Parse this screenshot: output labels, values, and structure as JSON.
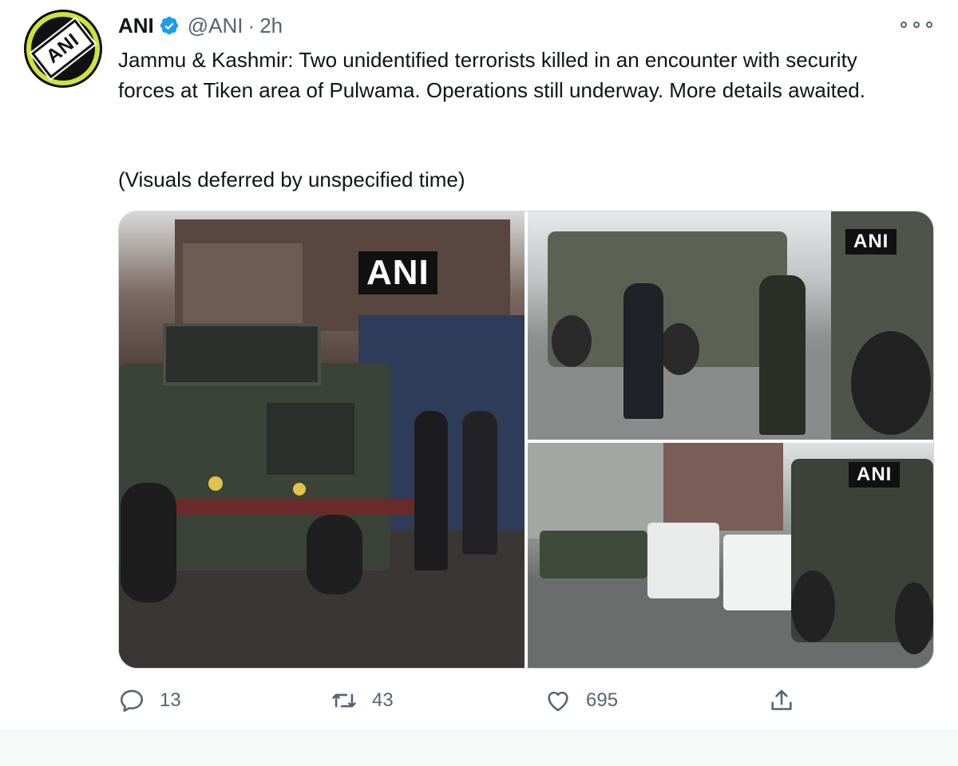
{
  "tweet": {
    "author_name": "ANI",
    "handle": "@ANI",
    "separator": "·",
    "time": "2h",
    "avatar_text": "ANI",
    "text": "Jammu & Kashmir: Two unidentified terrorists killed in an encounter with security forces at Tiken area of Pulwama. Operations still underway. More details awaited.",
    "text_secondary": "(Visuals deferred by unspecified time)",
    "media": {
      "watermark_left": "ANI",
      "watermark_top_right": "ANI",
      "watermark_bottom_right": "ANI"
    },
    "actions": {
      "reply_count": "13",
      "retweet_count": "43",
      "like_count": "695"
    }
  },
  "colors": {
    "text": "#0f1419",
    "secondary": "#536471",
    "verified": "#1d9bf0"
  },
  "icons": [
    "verified-badge-icon",
    "more-options-icon",
    "reply-icon",
    "retweet-icon",
    "like-icon",
    "share-icon"
  ]
}
